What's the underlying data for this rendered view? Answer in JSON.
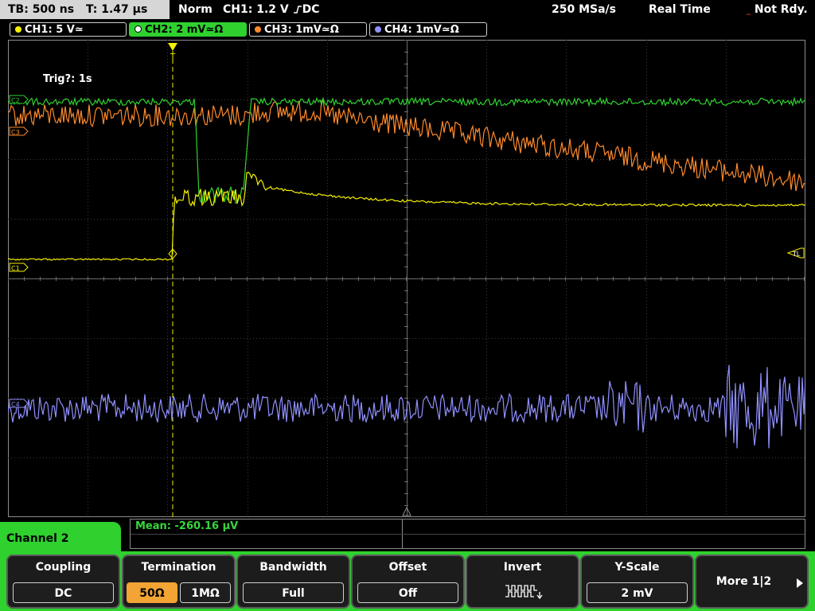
{
  "status": {
    "timebase": "TB: 500 ns",
    "trigger_time": "T: 1.47 µs",
    "mode": "Norm",
    "trigger": "CH1: 1.2 V",
    "trigger_suffix": "DC",
    "sample_rate": "250 MSa/s",
    "acq_mode": "Real Time",
    "state": "Not Rdy."
  },
  "channels": [
    {
      "label": "CH1: 5 V",
      "suffix": "≃",
      "color": "#f5f000"
    },
    {
      "label": "CH2: 2 mV",
      "suffix": "≃Ω",
      "color": "#2fd12f"
    },
    {
      "label": "CH3: 1mV",
      "suffix": "≃Ω",
      "color": "#ff8a2b"
    },
    {
      "label": "CH4: 1mV",
      "suffix": "≃Ω",
      "color": "#9090ff"
    }
  ],
  "plot": {
    "trig_label": "Trig?: 1s",
    "markers": {
      "c2": "C2",
      "c3": "C3",
      "c1": "C1",
      "c4": "C4",
      "tl": "TL"
    }
  },
  "info": {
    "mean": "Mean: -260.16 µV"
  },
  "menu": {
    "title": "Channel 2",
    "coupling": {
      "label": "Coupling",
      "value": "DC"
    },
    "termination": {
      "label": "Termination",
      "opt1": "50Ω",
      "opt2": "1MΩ"
    },
    "bandwidth": {
      "label": "Bandwidth",
      "value": "Full"
    },
    "offset": {
      "label": "Offset",
      "value": "Off"
    },
    "invert": {
      "label": "Invert"
    },
    "yscale": {
      "label": "Y-Scale",
      "value": "2 mV"
    },
    "more": {
      "label": "More 1|2"
    }
  }
}
